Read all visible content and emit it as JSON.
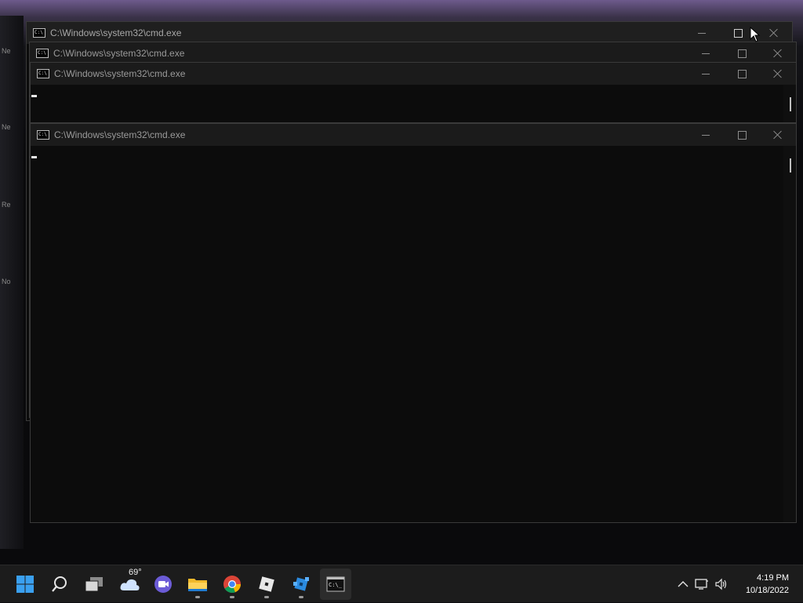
{
  "desktop": {
    "labels": [
      "Ne",
      "Ne",
      "Re",
      "No"
    ]
  },
  "windows": [
    {
      "title": "C:\\Windows\\system32\\cmd.exe",
      "state": "active"
    },
    {
      "title": "C:\\Windows\\system32\\cmd.exe",
      "state": "inactive"
    },
    {
      "title": "C:\\Windows\\system32\\cmd.exe",
      "state": "inactive"
    },
    {
      "title": "C:\\Windows\\system32\\cmd.exe",
      "state": "inactive"
    }
  ],
  "taskbar": {
    "items": [
      {
        "name": "start",
        "icon": "windows-logo-icon"
      },
      {
        "name": "search",
        "icon": "search-icon"
      },
      {
        "name": "task-view",
        "icon": "task-view-icon"
      },
      {
        "name": "widgets",
        "icon": "weather-cloud-icon",
        "temperature": "69°"
      },
      {
        "name": "chat",
        "icon": "video-chat-icon"
      },
      {
        "name": "file-explorer",
        "icon": "folder-icon"
      },
      {
        "name": "chrome",
        "icon": "chrome-icon"
      },
      {
        "name": "roblox",
        "icon": "roblox-icon"
      },
      {
        "name": "roblox-studio",
        "icon": "roblox-studio-icon"
      },
      {
        "name": "command-prompt",
        "icon": "cmd-icon"
      }
    ],
    "tray": {
      "chevron": "chevron-up-icon",
      "network": "network-icon",
      "volume": "volume-icon"
    },
    "clock": {
      "time": "4:19 PM",
      "date": "10/18/2022"
    }
  },
  "colors": {
    "terminal_bg": "#0c0c0c",
    "titlebar_bg": "#1f1f1f",
    "taskbar_bg": "#1c1c1c",
    "accent_focus": "#c9a8ff"
  }
}
